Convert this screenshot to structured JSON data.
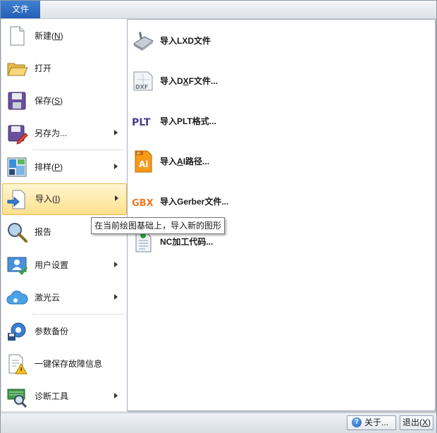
{
  "file_tab": "文件",
  "menu": [
    {
      "key": "new",
      "prefix": "新建(",
      "mn": "N",
      "suffix": ")",
      "arrow": false,
      "active": false
    },
    {
      "key": "open",
      "prefix": "打开",
      "mn": "",
      "suffix": "",
      "arrow": false,
      "active": false
    },
    {
      "key": "save",
      "prefix": "保存(",
      "mn": "S",
      "suffix": ")",
      "arrow": false,
      "active": false
    },
    {
      "key": "saveas",
      "prefix": "另存为...",
      "mn": "",
      "suffix": "",
      "arrow": true,
      "active": false
    },
    {
      "key": "nest",
      "prefix": "排样(",
      "mn": "P",
      "suffix": ")",
      "arrow": true,
      "active": false
    },
    {
      "key": "import",
      "prefix": "导入(",
      "mn": "I",
      "suffix": ")",
      "arrow": true,
      "active": true
    },
    {
      "key": "report",
      "prefix": "报告",
      "mn": "",
      "suffix": "",
      "arrow": false,
      "active": false
    },
    {
      "key": "usersettings",
      "prefix": "用户设置",
      "mn": "",
      "suffix": "",
      "arrow": true,
      "active": false
    },
    {
      "key": "lasercloud",
      "prefix": "激光云",
      "mn": "",
      "suffix": "",
      "arrow": true,
      "active": false
    },
    {
      "key": "paramsbackup",
      "prefix": "参数备份",
      "mn": "",
      "suffix": "",
      "arrow": false,
      "active": false
    },
    {
      "key": "savefault",
      "prefix": "一键保存故障信息",
      "mn": "",
      "suffix": "",
      "arrow": false,
      "active": false
    },
    {
      "key": "diagnose",
      "prefix": "诊断工具",
      "mn": "",
      "suffix": "",
      "arrow": true,
      "active": false
    }
  ],
  "submenu": [
    {
      "key": "lxd",
      "prefix": "导入LXD文件",
      "mn": "",
      "suffix": ""
    },
    {
      "key": "dxf",
      "prefix": "导入D",
      "mn": "X",
      "suffix": "F文件..."
    },
    {
      "key": "plt",
      "prefix": "导入PLT格式...",
      "mn": "",
      "suffix": ""
    },
    {
      "key": "ai",
      "prefix": "导入",
      "mn": "A",
      "suffix": "I路径..."
    },
    {
      "key": "gerber",
      "prefix": "导入Gerber文件...",
      "mn": "",
      "suffix": ""
    },
    {
      "key": "nc",
      "prefix": "NC加工代码...",
      "mn": "",
      "suffix": ""
    }
  ],
  "icon_text": {
    "dxf": "DXF",
    "plt": "PLT",
    "ai_top": "AI",
    "ai": "Ai",
    "gbx": "GBX"
  },
  "tooltip": "在当前绘图基础上，导入新的图形",
  "about": {
    "label": "关于..."
  },
  "exit": {
    "prefix": "退出(",
    "mn": "X",
    "suffix": ")"
  }
}
